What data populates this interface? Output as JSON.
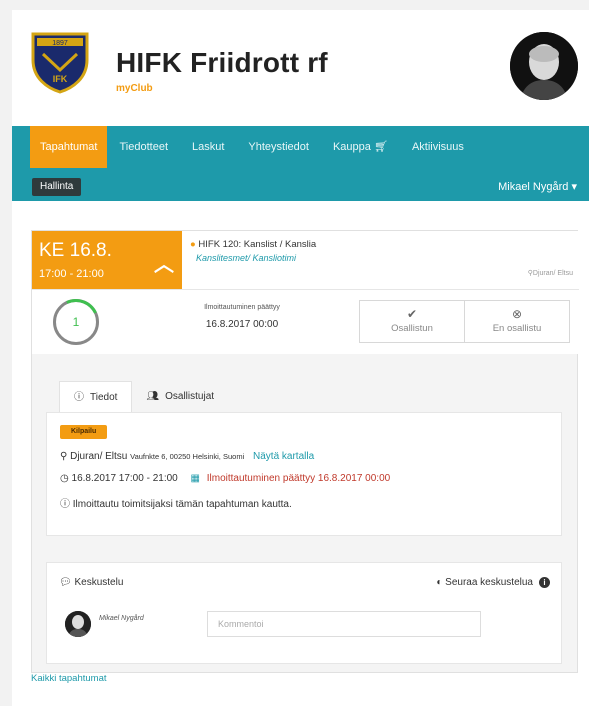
{
  "header": {
    "title": "HIFK Friidrott rf",
    "subtitle": "myClub"
  },
  "nav": {
    "items": [
      {
        "label": "Tapahtumat",
        "active": true
      },
      {
        "label": "Tiedotteet"
      },
      {
        "label": "Laskut"
      },
      {
        "label": "Yhteystiedot"
      },
      {
        "label": "Kauppa"
      },
      {
        "label": "Aktiivisuus"
      }
    ],
    "admin_label": "Hallinta",
    "user": "Mikael Nygård"
  },
  "event": {
    "day": "KE 16.8.",
    "time": "17:00 - 21:00",
    "title": "HIFK 120: Kanslist / Kanslia",
    "category": "Kanslitesmet/ Kansliotimi",
    "location_short": "Djuran/ Eltsu",
    "participant_count": "1",
    "deadline_label": "Ilmoittautuminen päättyy",
    "deadline_value": "16.8.2017 00:00",
    "attend_label": "Osallistun",
    "decline_label": "En osallistu"
  },
  "tabs": [
    {
      "label": "Tiedot",
      "active": true
    },
    {
      "label": "Osallistujat"
    }
  ],
  "details": {
    "badge": "Kilpailu",
    "location": "Djuran/ Eltsu",
    "address": "Vaufnkte 6, 00250 Helsinki, Suomi",
    "map_link": "Näytä kartalla",
    "datetime": "16.8.2017 17:00 - 21:00",
    "registration_ends": "Ilmoittautuminen päättyy 16.8.2017 00:00",
    "note": "Ilmoittautu toimitsijaksi tämän tapahtuman kautta."
  },
  "discussion": {
    "title": "Keskustelu",
    "follow_label": "Seuraa keskustelua",
    "commenter": "Mikael Nygård",
    "comment_placeholder": "Kommentoi"
  },
  "footer": {
    "all_events_link": "Kaikki tapahtumat"
  },
  "colors": {
    "primary": "#1e9aaa",
    "accent": "#f39c12",
    "admin_bg": "#2f3a3c",
    "alert": "#c0392b"
  }
}
